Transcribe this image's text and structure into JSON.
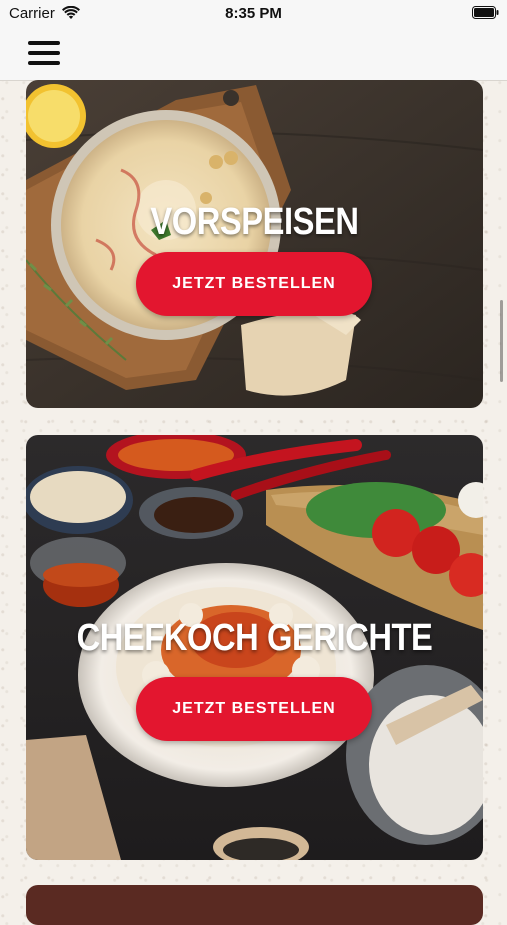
{
  "status_bar": {
    "carrier": "Carrier",
    "time": "8:35 PM"
  },
  "nav": {
    "menu_icon": "hamburger-menu-icon"
  },
  "categories": [
    {
      "title": "VORSPEISEN",
      "button_label": "JETZT BESTELLEN"
    },
    {
      "title": "CHEFKOCH GERICHTE",
      "button_label": "JETZT BESTELLEN"
    }
  ],
  "colors": {
    "accent": "#e3162f",
    "background": "#f4f0ea",
    "bar": "#f7f7f7"
  }
}
